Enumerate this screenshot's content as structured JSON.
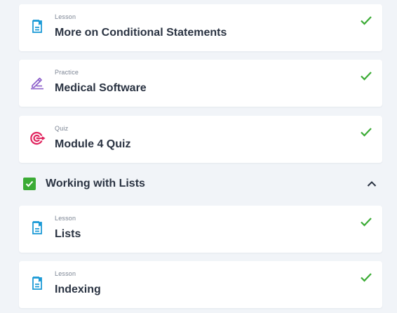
{
  "items": [
    {
      "type": "Lesson",
      "title": "More on Conditional Statements",
      "icon": "lesson-icon",
      "completed": true
    },
    {
      "type": "Practice",
      "title": "Medical Software",
      "icon": "pencil-icon",
      "completed": true
    },
    {
      "type": "Quiz",
      "title": "Module 4 Quiz",
      "icon": "target-icon",
      "completed": true
    }
  ],
  "section": {
    "title": "Working with Lists",
    "completed": true,
    "expanded": true
  },
  "section_items": [
    {
      "type": "Lesson",
      "title": "Lists",
      "icon": "lesson-icon",
      "completed": true
    },
    {
      "type": "Lesson",
      "title": "Indexing",
      "icon": "lesson-icon",
      "completed": true
    }
  ],
  "colors": {
    "lesson_icon": "#1b9ad6",
    "practice_icon": "#8a5cc9",
    "quiz_icon": "#e0245e",
    "check": "#3bab35",
    "text": "#2a3342",
    "background": "#f1f4f8"
  }
}
